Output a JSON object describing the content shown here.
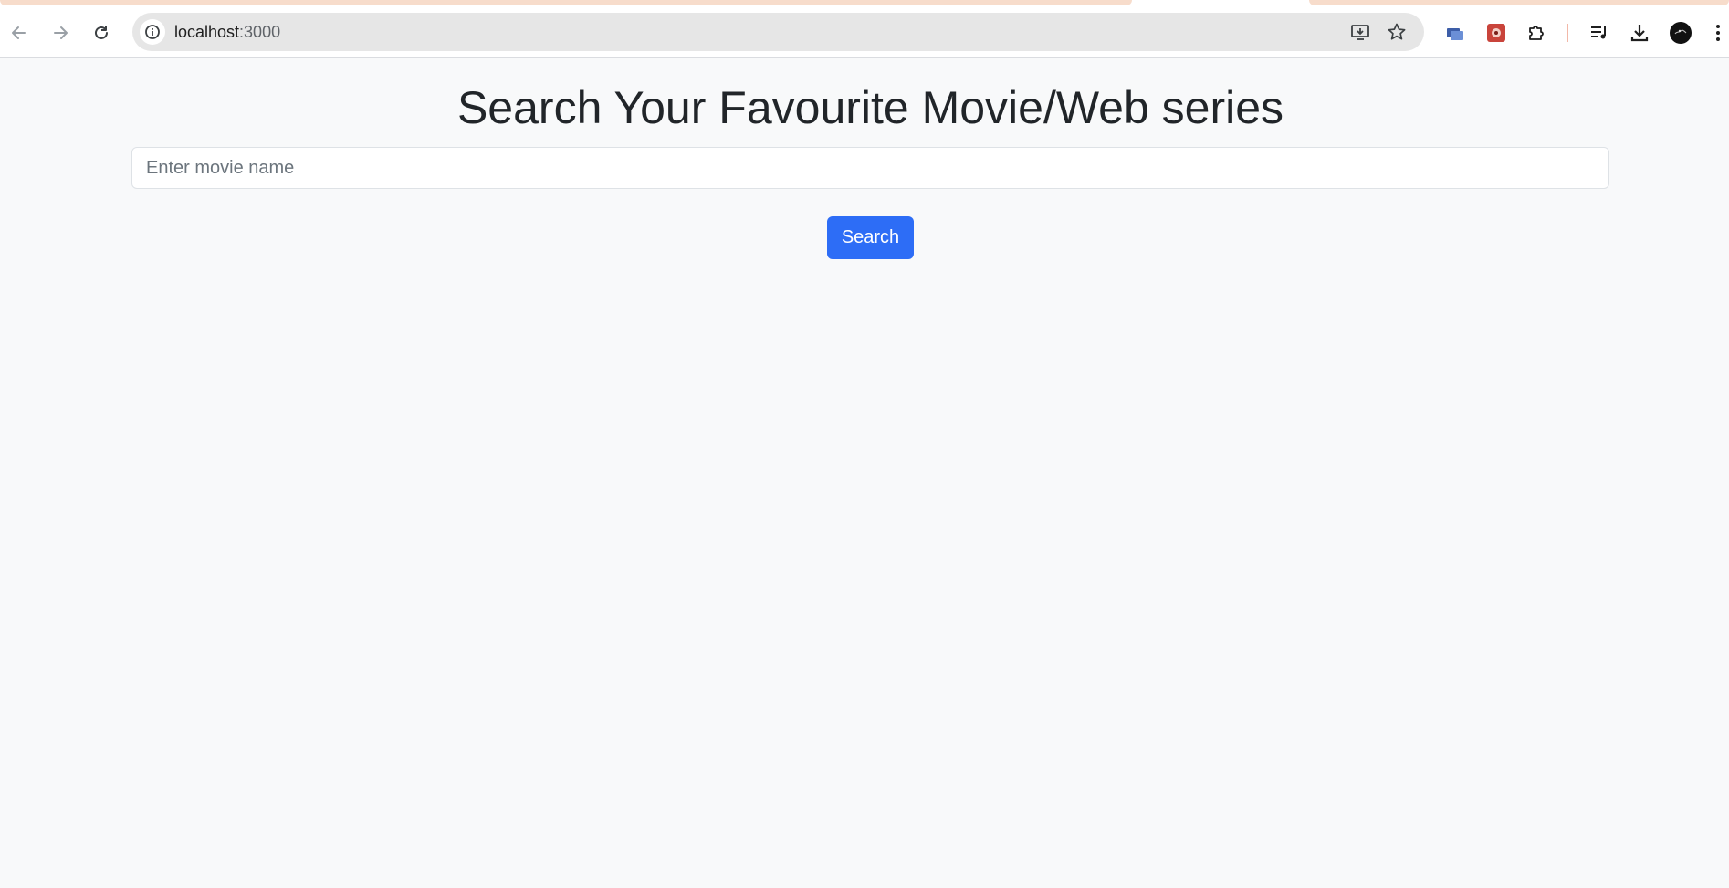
{
  "browser": {
    "address_bar": {
      "host": "localhost",
      "port": ":3000"
    },
    "icons": {
      "back": "back-arrow-icon",
      "forward": "forward-arrow-icon",
      "reload": "reload-icon",
      "site_info": "info-icon",
      "install": "install-app-icon",
      "bookmark": "star-icon",
      "extensions": "puzzle-icon",
      "media": "media-controls-icon",
      "downloads": "download-icon",
      "profile": "profile-avatar",
      "menu": "more-vert-icon"
    },
    "colors": {
      "tab_strip_accent": "#f7dccb",
      "omnibox_bg": "#e6e6e6"
    }
  },
  "page": {
    "title": "Search Your Favourite Movie/Web series",
    "search": {
      "placeholder": "Enter movie name",
      "value": ""
    },
    "search_button_label": "Search",
    "colors": {
      "background": "#f8f9fa",
      "primary": "#2d6df6",
      "text": "#212529"
    }
  }
}
